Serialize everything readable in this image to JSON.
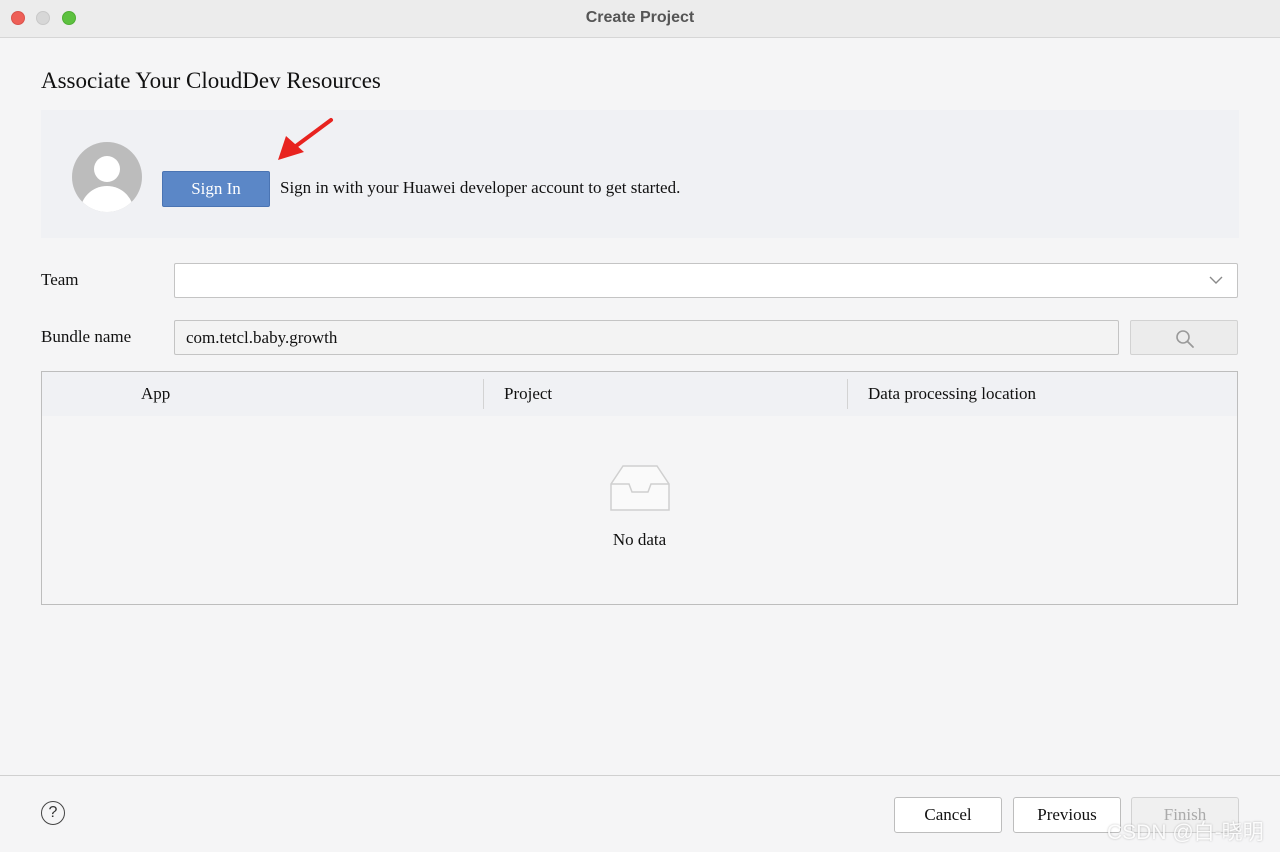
{
  "window": {
    "title": "Create Project"
  },
  "page": {
    "heading": "Associate Your CloudDev Resources"
  },
  "signin": {
    "button_label": "Sign In",
    "message": "Sign in with your Huawei developer account to get started."
  },
  "form": {
    "team_label": "Team",
    "team_value": "",
    "bundle_label": "Bundle name",
    "bundle_value": "com.tetcl.baby.growth"
  },
  "table": {
    "columns": [
      "App",
      "Project",
      "Data processing location"
    ],
    "empty_text": "No data"
  },
  "footer": {
    "help_symbol": "?",
    "cancel_label": "Cancel",
    "previous_label": "Previous",
    "finish_label": "Finish"
  },
  "watermark": "CSDN @白-晓明",
  "colors": {
    "primary_button": "#5b87c7",
    "annotation_arrow": "#e8231f",
    "traffic_close": "#ee5f57",
    "traffic_max": "#5dc13f"
  }
}
